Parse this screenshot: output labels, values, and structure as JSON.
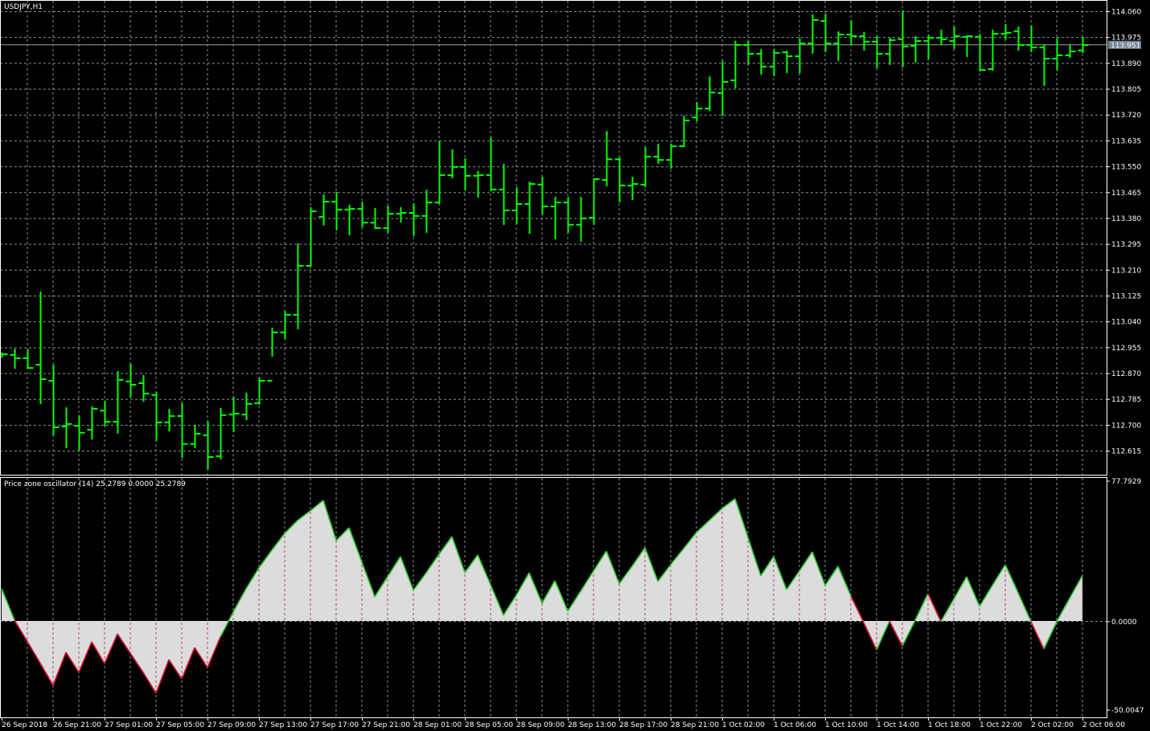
{
  "symbol_title": "USDJPY,H1",
  "indicator": {
    "name": "Price zone oscillator (14)",
    "values_text": "25.2789 0.0000 25.2789",
    "scale_max_label": "77.7929",
    "zero_label": "0.0000",
    "scale_min_label": "-50.0047"
  },
  "current_price": "113.951",
  "colors": {
    "background": "#000000",
    "bar": "#00ff00",
    "grid": "#8391a5",
    "osc_up": "#32cd32",
    "osc_down": "#dc143c",
    "osc_fill": "#dcdcdc",
    "price_badge": "#778899"
  },
  "chart_data": [
    {
      "type": "ohlc",
      "title": "USDJPY,H1",
      "ylim": [
        112.56,
        114.1
      ],
      "y_ticks": [
        "114.060",
        "113.975",
        "113.890",
        "113.805",
        "113.720",
        "113.635",
        "113.550",
        "113.465",
        "113.380",
        "113.295",
        "113.210",
        "113.125",
        "113.040",
        "112.955",
        "112.870",
        "112.785",
        "112.700",
        "112.615"
      ],
      "x_tick_labels": [
        {
          "bar": 0,
          "label": "26 Sep 2018"
        },
        {
          "bar": 4,
          "label": "26 Sep 21:00"
        },
        {
          "bar": 8,
          "label": "27 Sep 01:00"
        },
        {
          "bar": 12,
          "label": "27 Sep 05:00"
        },
        {
          "bar": 16,
          "label": "27 Sep 09:00"
        },
        {
          "bar": 20,
          "label": "27 Sep 13:00"
        },
        {
          "bar": 24,
          "label": "27 Sep 17:00"
        },
        {
          "bar": 28,
          "label": "27 Sep 21:00"
        },
        {
          "bar": 32,
          "label": "28 Sep 01:00"
        },
        {
          "bar": 36,
          "label": "28 Sep 05:00"
        },
        {
          "bar": 40,
          "label": "28 Sep 09:00"
        },
        {
          "bar": 44,
          "label": "28 Sep 13:00"
        },
        {
          "bar": 48,
          "label": "28 Sep 17:00"
        },
        {
          "bar": 52,
          "label": "28 Sep 21:00"
        },
        {
          "bar": 56,
          "label": "1 Oct 02:00"
        },
        {
          "bar": 60,
          "label": "1 Oct 06:00"
        },
        {
          "bar": 64,
          "label": "1 Oct 10:00"
        },
        {
          "bar": 68,
          "label": "1 Oct 14:00"
        },
        {
          "bar": 72,
          "label": "1 Oct 18:00"
        },
        {
          "bar": 76,
          "label": "1 Oct 22:00"
        },
        {
          "bar": 80,
          "label": "2 Oct 02:00"
        },
        {
          "bar": 84,
          "label": "2 Oct 06:00"
        }
      ],
      "ohlc": [
        [
          112.932,
          112.935,
          112.924,
          112.932
        ],
        [
          112.93,
          112.948,
          112.887,
          112.919
        ],
        [
          112.919,
          112.946,
          112.887,
          112.887
        ],
        [
          112.898,
          113.136,
          112.771,
          112.85
        ],
        [
          112.845,
          112.895,
          112.668,
          112.692
        ],
        [
          112.695,
          112.755,
          112.626,
          112.703
        ],
        [
          112.697,
          112.729,
          112.618,
          112.674
        ],
        [
          112.684,
          112.758,
          112.655,
          112.753
        ],
        [
          112.747,
          112.777,
          112.697,
          112.71
        ],
        [
          112.71,
          112.874,
          112.674,
          112.848
        ],
        [
          112.843,
          112.898,
          112.792,
          112.832
        ],
        [
          112.837,
          112.861,
          112.779,
          112.803
        ],
        [
          112.798,
          112.806,
          112.65,
          112.708
        ],
        [
          112.708,
          112.75,
          112.681,
          112.729
        ],
        [
          112.729,
          112.769,
          112.594,
          112.637
        ],
        [
          112.637,
          112.697,
          112.626,
          112.671
        ],
        [
          112.666,
          112.71,
          112.555,
          112.594
        ],
        [
          112.597,
          112.753,
          112.589,
          112.732
        ],
        [
          112.734,
          112.79,
          112.679,
          112.737
        ],
        [
          112.734,
          112.803,
          112.718,
          112.769
        ],
        [
          112.771,
          112.853,
          112.769,
          112.845
        ],
        [
          112.845,
          113.017,
          112.927,
          113.004
        ],
        [
          113.004,
          113.072,
          112.985,
          113.062
        ],
        [
          113.062,
          113.294,
          113.017,
          113.223
        ],
        [
          113.223,
          113.413,
          113.223,
          113.402
        ],
        [
          113.384,
          113.455,
          113.358,
          113.434
        ],
        [
          113.434,
          113.463,
          113.342,
          113.408
        ],
        [
          113.408,
          113.421,
          113.326,
          113.41
        ],
        [
          113.41,
          113.431,
          113.352,
          113.365
        ],
        [
          113.365,
          113.41,
          113.347,
          113.347
        ],
        [
          113.347,
          113.418,
          113.334,
          113.394
        ],
        [
          113.394,
          113.413,
          113.368,
          113.397
        ],
        [
          113.397,
          113.426,
          113.323,
          113.387
        ],
        [
          113.387,
          113.471,
          113.334,
          113.431
        ],
        [
          113.431,
          113.632,
          113.429,
          113.521
        ],
        [
          113.521,
          113.603,
          113.513,
          113.548
        ],
        [
          113.548,
          113.574,
          113.474,
          113.519
        ],
        [
          113.519,
          113.532,
          113.45,
          113.521
        ],
        [
          113.521,
          113.643,
          113.471,
          113.474
        ],
        [
          113.474,
          113.556,
          113.36,
          113.405
        ],
        [
          113.405,
          113.479,
          113.363,
          113.426
        ],
        [
          113.426,
          113.497,
          113.331,
          113.492
        ],
        [
          113.49,
          113.513,
          113.394,
          113.418
        ],
        [
          113.418,
          113.447,
          113.313,
          113.431
        ],
        [
          113.431,
          113.447,
          113.334,
          113.358
        ],
        [
          113.358,
          113.447,
          113.305,
          113.379
        ],
        [
          113.381,
          113.508,
          113.36,
          113.508
        ],
        [
          113.505,
          113.664,
          113.487,
          113.573
        ],
        [
          113.573,
          113.578,
          113.434,
          113.487
        ],
        [
          113.487,
          113.513,
          113.442,
          113.492
        ],
        [
          113.49,
          113.611,
          113.484,
          113.582
        ],
        [
          113.582,
          113.622,
          113.561,
          113.571
        ],
        [
          113.571,
          113.622,
          113.545,
          113.616
        ],
        [
          113.616,
          113.714,
          113.616,
          113.701
        ],
        [
          113.711,
          113.759,
          113.701,
          113.74
        ],
        [
          113.74,
          113.843,
          113.735,
          113.793
        ],
        [
          113.791,
          113.894,
          113.719,
          113.828
        ],
        [
          113.833,
          113.96,
          113.809,
          113.949
        ],
        [
          113.949,
          113.96,
          113.886,
          113.92
        ],
        [
          113.92,
          113.933,
          113.854,
          113.878
        ],
        [
          113.878,
          113.933,
          113.849,
          113.923
        ],
        [
          113.925,
          113.928,
          113.859,
          113.912
        ],
        [
          113.912,
          113.97,
          113.859,
          113.954
        ],
        [
          113.954,
          114.047,
          113.923,
          114.031
        ],
        [
          114.028,
          114.049,
          113.928,
          113.954
        ],
        [
          113.954,
          113.991,
          113.899,
          113.983
        ],
        [
          113.983,
          114.028,
          113.952,
          113.978
        ],
        [
          113.978,
          113.989,
          113.933,
          113.96
        ],
        [
          113.96,
          113.976,
          113.875,
          113.92
        ],
        [
          113.92,
          113.97,
          113.886,
          113.965
        ],
        [
          113.968,
          114.06,
          113.878,
          113.944
        ],
        [
          113.946,
          113.976,
          113.894,
          113.962
        ],
        [
          113.962,
          113.981,
          113.904,
          113.973
        ],
        [
          113.973,
          113.997,
          113.952,
          113.968
        ],
        [
          113.962,
          114.007,
          113.939,
          113.978
        ],
        [
          113.976,
          113.978,
          113.912,
          113.978
        ],
        [
          113.976,
          113.983,
          113.865,
          113.867
        ],
        [
          113.87,
          113.997,
          113.867,
          113.986
        ],
        [
          113.986,
          114.015,
          113.97,
          113.989
        ],
        [
          113.994,
          114.007,
          113.933,
          113.949
        ],
        [
          113.949,
          114.01,
          113.928,
          113.941
        ],
        [
          113.941,
          113.949,
          113.817,
          113.904
        ],
        [
          113.904,
          113.97,
          113.867,
          113.915
        ],
        [
          113.915,
          113.949,
          113.909,
          113.928
        ],
        [
          113.931,
          113.973,
          113.925,
          113.949
        ]
      ]
    },
    {
      "type": "area",
      "title": "Price zone oscillator (14)",
      "ylim": [
        -50.0047,
        77.7929
      ],
      "values": [
        17.9,
        0.4,
        -11.4,
        -23.5,
        -35.8,
        -17.4,
        -28.6,
        -11.6,
        -23.7,
        -7.2,
        -17.9,
        -28.6,
        -40.2,
        -21.5,
        -32.2,
        -14.8,
        -25.9,
        -8.9,
        4.9,
        17.9,
        29.5,
        39.3,
        48.7,
        55.9,
        61.3,
        67.1,
        44.7,
        51.9,
        32.6,
        13.4,
        24.6,
        35.8,
        17.0,
        26.8,
        37.1,
        46.9,
        26.8,
        36.7,
        20.1,
        3.1,
        14.3,
        26.8,
        9.8,
        22.4,
        5.4,
        16.5,
        27.7,
        38.9,
        20.6,
        30.4,
        40.7,
        21.9,
        31.3,
        40.2,
        49.2,
        55.9,
        62.6,
        68.0,
        46.5,
        25.0,
        35.8,
        17.4,
        27.7,
        38.5,
        19.7,
        30.4,
        13.9,
        -0.9,
        -16.1,
        0.0,
        -13.9,
        0.4,
        15.2,
        -0.4,
        12.1,
        24.6,
        8.0,
        19.7,
        31.3,
        15.6,
        -0.4,
        -15.6,
        -0.4,
        12.5,
        25.2789
      ],
      "down_segments": [
        1,
        2,
        3,
        4,
        5,
        6,
        7,
        8,
        9,
        10,
        11,
        12,
        13,
        14,
        15,
        16,
        66,
        67,
        69,
        72,
        80
      ]
    }
  ]
}
